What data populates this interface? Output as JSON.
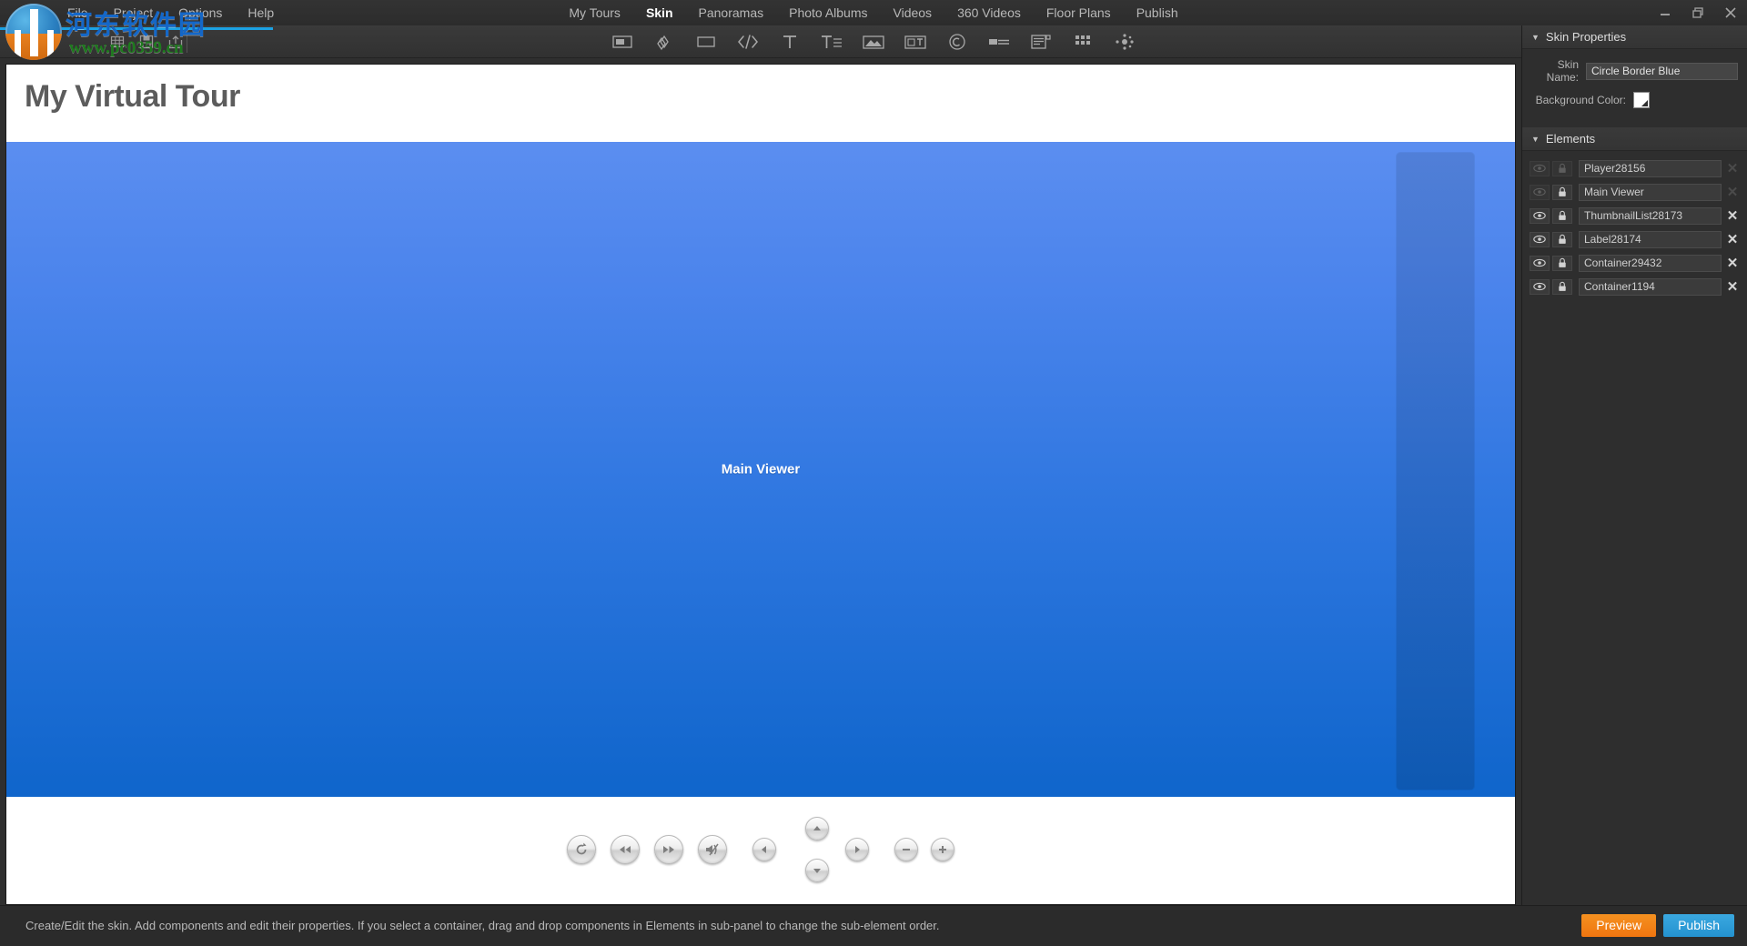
{
  "window": {
    "controls": [
      {
        "name": "minimize",
        "glyph": "minimize-icon"
      },
      {
        "name": "restore",
        "glyph": "restore-icon"
      },
      {
        "name": "close",
        "glyph": "close-icon"
      }
    ]
  },
  "menubar": {
    "left_items": [
      {
        "label": "File"
      },
      {
        "label": "Project"
      },
      {
        "label": "Options"
      },
      {
        "label": "Help"
      }
    ],
    "center_items": [
      {
        "label": "My Tours",
        "active": false
      },
      {
        "label": "Skin",
        "active": true
      },
      {
        "label": "Panoramas",
        "active": false
      },
      {
        "label": "Photo Albums",
        "active": false
      },
      {
        "label": "Videos",
        "active": false
      },
      {
        "label": "360 Videos",
        "active": false
      },
      {
        "label": "Floor Plans",
        "active": false
      },
      {
        "label": "Publish",
        "active": false
      }
    ]
  },
  "toolbar": {
    "left_icons": [
      {
        "name": "grid-icon"
      },
      {
        "name": "save-icon"
      },
      {
        "name": "export-icon"
      }
    ],
    "center_icons": [
      {
        "name": "container-icon"
      },
      {
        "name": "hotspot-icon"
      },
      {
        "name": "rectangle-icon"
      },
      {
        "name": "code-icon"
      },
      {
        "name": "text-icon"
      },
      {
        "name": "text-block-icon"
      },
      {
        "name": "image-icon"
      },
      {
        "name": "thumbnail-list-icon"
      },
      {
        "name": "compass-icon"
      },
      {
        "name": "progress-bar-icon"
      },
      {
        "name": "popup-icon"
      },
      {
        "name": "grid-tiles-icon"
      },
      {
        "name": "dots-icon"
      }
    ]
  },
  "watermark": {
    "chinese": "河东软件园",
    "url": "www.pc0359.cn"
  },
  "canvas": {
    "tour_title": "My Virtual Tour",
    "viewer_label": "Main Viewer",
    "colors": {
      "viewer_top": "#5b8ef0",
      "viewer_bottom": "#0f65cb"
    },
    "player_controls": [
      {
        "name": "rotate-button",
        "glyph": "rotate-icon",
        "size": "lg"
      },
      {
        "name": "rewind-button",
        "glyph": "rewind-icon",
        "size": "lg"
      },
      {
        "name": "forward-button",
        "glyph": "forward-icon",
        "size": "lg"
      },
      {
        "name": "mute-button",
        "glyph": "mute-icon",
        "size": "lg"
      },
      {
        "name": "pan-left-button",
        "glyph": "arrow-left-icon",
        "size": "md"
      },
      {
        "name": "pan-up-button",
        "glyph": "arrow-up-icon",
        "size": "md"
      },
      {
        "name": "pan-down-button",
        "glyph": "arrow-down-icon",
        "size": "md"
      },
      {
        "name": "pan-right-button",
        "glyph": "arrow-right-icon",
        "size": "md"
      },
      {
        "name": "zoom-out-button",
        "glyph": "minus-icon",
        "size": "md"
      },
      {
        "name": "zoom-in-button",
        "glyph": "plus-icon",
        "size": "md"
      }
    ]
  },
  "right_panel": {
    "skin_properties": {
      "header": "Skin Properties",
      "skin_name_label": "Skin Name:",
      "skin_name_value": "Circle Border Blue",
      "background_color_label": "Background Color:",
      "background_color_value": "#ffffff"
    },
    "elements": {
      "header": "Elements",
      "rows": [
        {
          "name": "Player28156",
          "visible_enabled": false,
          "lock_enabled": false,
          "removable": false
        },
        {
          "name": "Main Viewer",
          "visible_enabled": false,
          "lock_enabled": true,
          "removable": false
        },
        {
          "name": "ThumbnailList28173",
          "visible_enabled": true,
          "lock_enabled": true,
          "removable": true
        },
        {
          "name": "Label28174",
          "visible_enabled": true,
          "lock_enabled": true,
          "removable": true
        },
        {
          "name": "Container29432",
          "visible_enabled": true,
          "lock_enabled": true,
          "removable": true
        },
        {
          "name": "Container1194",
          "visible_enabled": true,
          "lock_enabled": true,
          "removable": true
        }
      ],
      "remove_glyph": "✕"
    }
  },
  "statusbar": {
    "text": "Create/Edit the skin. Add components and edit their properties. If you select a container, drag and drop components in Elements in sub-panel to change the sub-element order.",
    "preview_label": "Preview",
    "publish_label": "Publish",
    "preview_color": "#f07b12",
    "publish_color": "#2d9bd6"
  }
}
